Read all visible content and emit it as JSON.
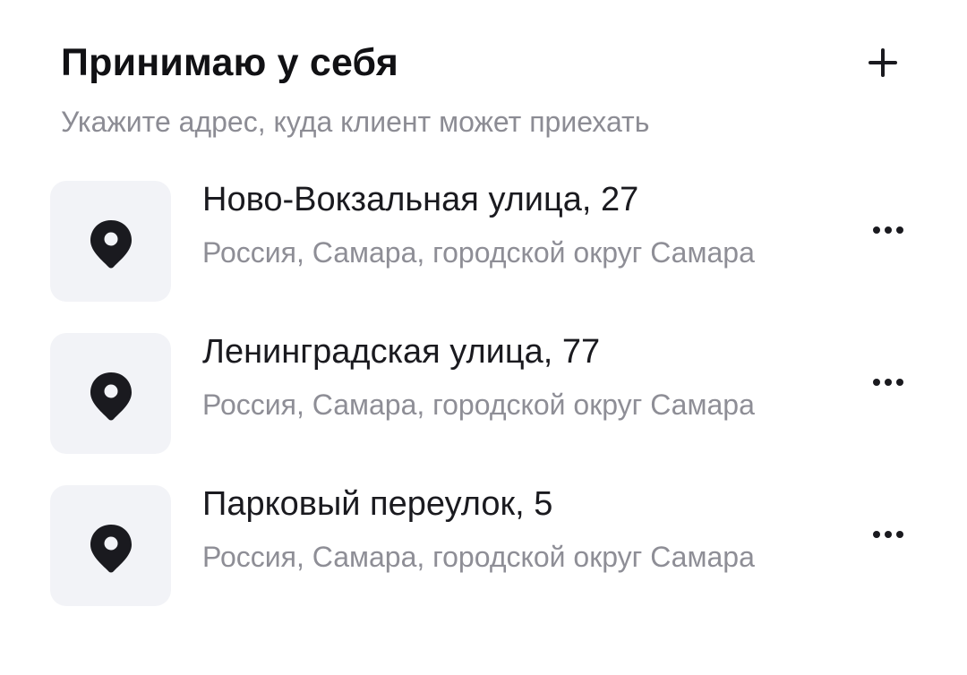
{
  "header": {
    "title": "Принимаю у себя",
    "subtitle": "Укажите адрес, куда клиент может приехать",
    "add_icon": "plus-icon"
  },
  "addresses": [
    {
      "street": "Ново-Вокзальная улица, 27",
      "region": "Россия, Самара, городской округ Самара",
      "icon": "location-pin-icon",
      "menu_icon": "more-horizontal-icon"
    },
    {
      "street": "Ленинградская улица, 77",
      "region": "Россия, Самара, городской округ Самара",
      "icon": "location-pin-icon",
      "menu_icon": "more-horizontal-icon"
    },
    {
      "street": "Парковый переулок, 5",
      "region": "Россия, Самара, городской округ Самара",
      "icon": "location-pin-icon",
      "menu_icon": "more-horizontal-icon"
    }
  ],
  "colors": {
    "title": "#111114",
    "subtitle": "#8c8c94",
    "tile_background": "#f2f3f7",
    "icon": "#1a1a1f"
  }
}
